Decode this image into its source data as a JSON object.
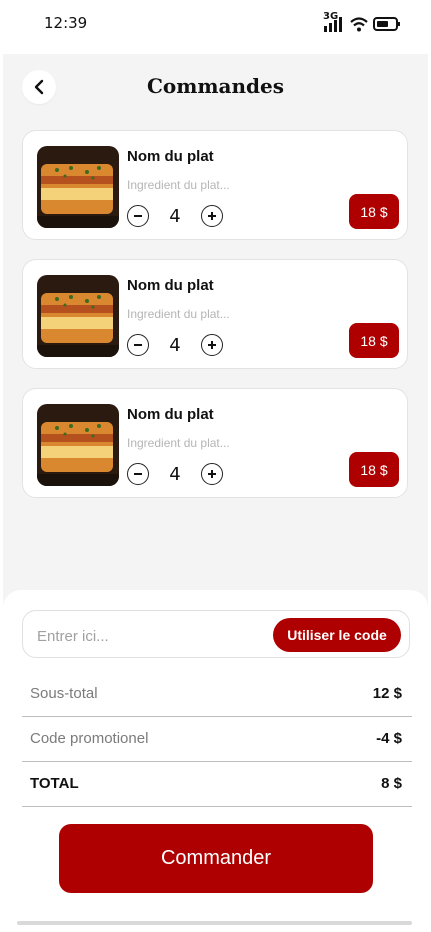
{
  "status": {
    "time": "12:39",
    "network": "3G"
  },
  "header": {
    "title": "Commandes"
  },
  "items": [
    {
      "name": "Nom du plat",
      "ingredients": "Ingredient du plat...",
      "quantity": "4",
      "price": "18 $"
    },
    {
      "name": "Nom du plat",
      "ingredients": "Ingredient du plat...",
      "quantity": "4",
      "price": "18 $"
    },
    {
      "name": "Nom du plat",
      "ingredients": "Ingredient du plat...",
      "quantity": "4",
      "price": "18 $"
    }
  ],
  "promo": {
    "placeholder": "Entrer ici...",
    "button_label": "Utiliser le code"
  },
  "summary": {
    "subtotal_label": "Sous-total",
    "subtotal_value": "12 $",
    "promo_label": "Code promotionel",
    "promo_value": "-4 $",
    "total_label": "TOTAL",
    "total_value": "8 $"
  },
  "order_button": {
    "label": "Commander"
  },
  "colors": {
    "accent": "#ae0000",
    "background": "#f4f4f4"
  }
}
